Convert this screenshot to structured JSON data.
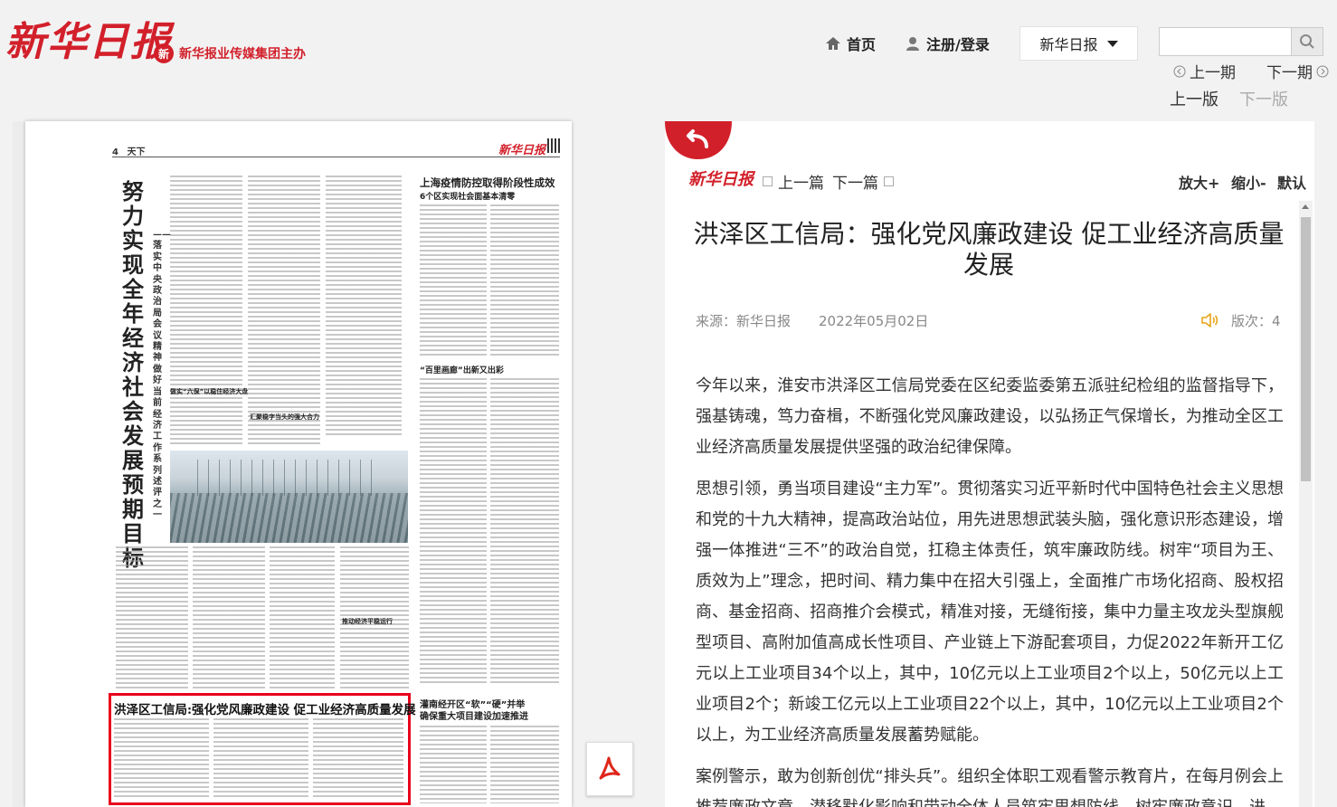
{
  "header": {
    "masthead": "新华日报",
    "group_logo_text": "新",
    "group_text": "新华报业传媒集团主办",
    "nav_home": "首页",
    "nav_login": "注册/登录",
    "paper_select": "新华日报",
    "search_placeholder": "",
    "prev_issue": "上一期",
    "next_issue": "下一期",
    "prev_edition": "上一版",
    "next_edition": "下一版"
  },
  "paper": {
    "page_no": "4",
    "section": "天下",
    "brand": "新华日报",
    "lead_title": "努力实现全年经济社会发展预期目标",
    "lead_subtitle": "——落实中央政治局会议精神做好当前经济工作系列述评之一",
    "side_title": "上海疫情防控取得阶段性成效",
    "side_subtitle": "6个区实现社会面基本清零",
    "side_title3": "“百里画廊”出新又出彩",
    "mid_head1": "做实“六保”以稳住经济大盘",
    "mid_head2": "汇聚稳字当头的强大合力",
    "mid_head3": "推动经济平稳运行",
    "highlight_title": "洪泽区工信局:强化党风廉政建设 促工业经济高质量发展",
    "side_title2a": "灌南经开区“软”“硬”并举",
    "side_title2b": "确保重大项目建设加速推进"
  },
  "article": {
    "logo": "新华日报",
    "prev_article": "上一篇",
    "next_article": "下一篇",
    "zoom_in": "放大+",
    "zoom_out": "缩小-",
    "zoom_reset": "默认",
    "title": "洪泽区工信局：强化党风廉政建设 促工业经济高质量发展",
    "source": "来源：新华日报",
    "date": "2022年05月02日",
    "edition": "版次：4",
    "paragraphs": [
      "今年以来，淮安市洪泽区工信局党委在区纪委监委第五派驻纪检组的监督指导下，强基铸魂，笃力奋楫，不断强化党风廉政建设，以弘扬正气保增长，为推动全区工业经济高质量发展提供坚强的政治纪律保障。",
      "思想引领，勇当项目建设“主力军”。贯彻落实习近平新时代中国特色社会主义思想和党的十九大精神，提高政治站位，用先进思想武装头脑，强化意识形态建设，增强一体推进“三不”的政治自觉，扛稳主体责任，筑牢廉政防线。树牢“项目为王、质效为上”理念，把时间、精力集中在招大引强上，全面推广市场化招商、股权招商、基金招商、招商推介会模式，精准对接，无缝衔接，集中力量主攻龙头型旗舰型项目、高附加值高成长性项目、产业链上下游配套项目，力促2022年新开工亿元以上工业项目34个以上，其中，10亿元以上工业项目2个以上，50亿元以上工业项目2个；新竣工亿元以上工业项目22个以上，其中，10亿元以上工业项目2个以上，为工业经济高质量发展蓄势赋能。",
      "案例警示，敢为创新创优“排头兵”。组织全体职工观看警示教育片，在每月例会上推荐廉政文章，潜移默化影响和带动全体人员筑牢思想防线，树牢廉政意识，进"
    ]
  }
}
